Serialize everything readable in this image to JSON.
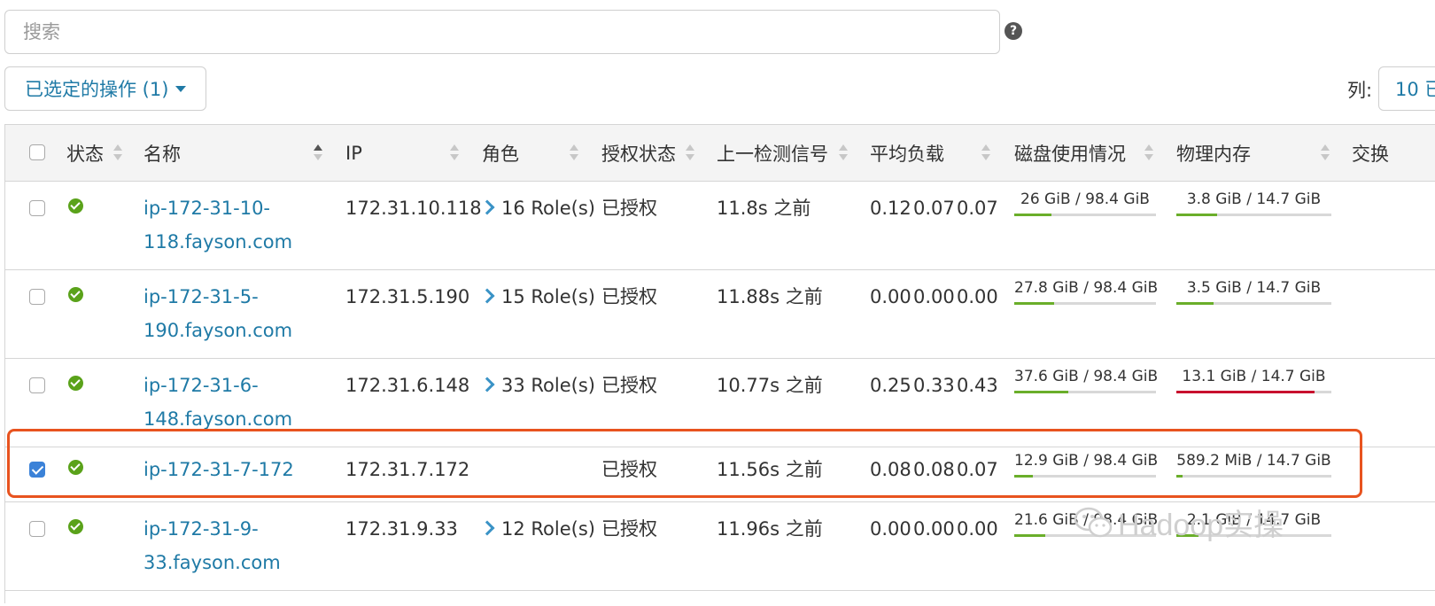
{
  "search": {
    "placeholder": "搜索"
  },
  "toolbar": {
    "actions_label": "已选定的操作 (1)",
    "columns_label": "列:",
    "columns_value": "10 已"
  },
  "table": {
    "headers": {
      "status": "状态",
      "name": "名称",
      "ip": "IP",
      "roles": "角色",
      "auth": "授权状态",
      "heartbeat": "上一检测信号",
      "load": "平均负载",
      "disk": "磁盘使用情况",
      "memory": "物理内存",
      "swap": "交换"
    },
    "rows": [
      {
        "checked": false,
        "name_line1": "ip-172-31-10-",
        "name_line2": "118.fayson.com",
        "ip": "172.31.10.118",
        "roles": "16 Role(s)",
        "auth": "已授权",
        "heartbeat": "11.8s 之前",
        "load": [
          "0.12",
          "0.07",
          "0.07"
        ],
        "disk": "26 GiB / 98.4 GiB",
        "disk_fraction": 0.264,
        "memory": "3.8 GiB / 14.7 GiB",
        "memory_fraction": 0.26,
        "memory_color": "#6aae2a"
      },
      {
        "checked": false,
        "name_line1": "ip-172-31-5-",
        "name_line2": "190.fayson.com",
        "ip": "172.31.5.190",
        "roles": "15 Role(s)",
        "auth": "已授权",
        "heartbeat": "11.88s 之前",
        "load": [
          "0.00",
          "0.00",
          "0.00"
        ],
        "disk": "27.8 GiB / 98.4 GiB",
        "disk_fraction": 0.283,
        "memory": "3.5 GiB / 14.7 GiB",
        "memory_fraction": 0.24,
        "memory_color": "#6aae2a"
      },
      {
        "checked": false,
        "name_line1": "ip-172-31-6-",
        "name_line2": "148.fayson.com",
        "ip": "172.31.6.148",
        "roles": "33 Role(s)",
        "auth": "已授权",
        "heartbeat": "10.77s 之前",
        "load": [
          "0.25",
          "0.33",
          "0.43"
        ],
        "disk": "37.6 GiB / 98.4 GiB",
        "disk_fraction": 0.382,
        "memory": "13.1 GiB / 14.7 GiB",
        "memory_fraction": 0.89,
        "memory_color": "#c8102e"
      },
      {
        "checked": true,
        "name_line1": "ip-172-31-7-172",
        "name_line2": "",
        "ip": "172.31.7.172",
        "roles": "",
        "auth": "已授权",
        "heartbeat": "11.56s 之前",
        "load": [
          "0.08",
          "0.08",
          "0.07"
        ],
        "disk": "12.9 GiB / 98.4 GiB",
        "disk_fraction": 0.131,
        "memory": "589.2 MiB / 14.7 GiB",
        "memory_fraction": 0.04,
        "memory_color": "#6aae2a"
      },
      {
        "checked": false,
        "name_line1": "ip-172-31-9-",
        "name_line2": "33.fayson.com",
        "ip": "172.31.9.33",
        "roles": "12 Role(s)",
        "auth": "已授权",
        "heartbeat": "11.96s 之前",
        "load": [
          "0.00",
          "0.00",
          "0.00"
        ],
        "disk": "21.6 GiB / 98.4 GiB",
        "disk_fraction": 0.22,
        "memory": "2.1 GiB / 14.7 GiB",
        "memory_fraction": 0.14,
        "memory_color": "#6aae2a"
      }
    ]
  },
  "watermark": {
    "text": "Hadoop实操"
  },
  "colors": {
    "link": "#1f7aa6",
    "ok": "#5aa21a",
    "bar_ok": "#6aae2a",
    "bar_high": "#c8102e",
    "highlight": "#e8531f"
  }
}
